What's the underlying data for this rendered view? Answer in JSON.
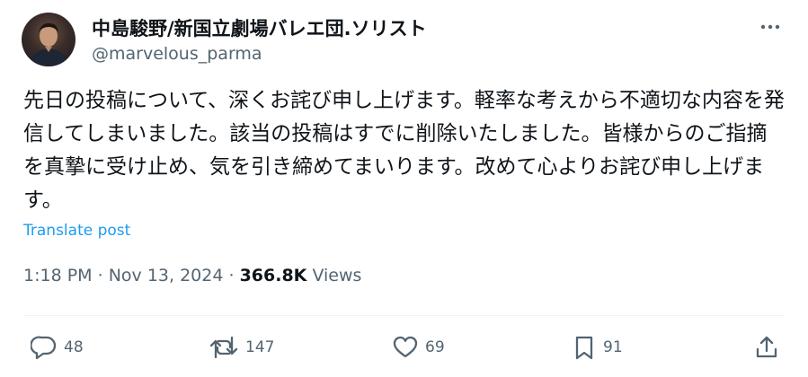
{
  "author": {
    "display_name": "中島駿野/新国立劇場バレエ団.ソリスト",
    "handle": "@marvelous_parma"
  },
  "post": {
    "text": "先日の投稿について、深くお詫び申し上げます。軽率な考えから不適切な内容を発信してしまいました。該当の投稿はすでに削除いたしました。皆様からのご指摘を真摯に受け止め、気を引き締めてまいります。改めて心よりお詫び申し上げます。",
    "translate_label": "Translate post"
  },
  "meta": {
    "time": "1:18 PM",
    "separator": "·",
    "date": "Nov 13, 2024",
    "views_count": "366.8K",
    "views_label": "Views"
  },
  "actions": {
    "replies": "48",
    "reposts": "147",
    "likes": "69",
    "bookmarks": "91"
  },
  "icons": {
    "more": "more-horizontal-icon",
    "reply": "reply-icon",
    "repost": "repost-icon",
    "like": "heart-icon",
    "bookmark": "bookmark-icon",
    "share": "share-icon"
  },
  "colors": {
    "text": "#0f1419",
    "secondary": "#536471",
    "link": "#1d9bf0",
    "divider": "#eff3f4"
  }
}
